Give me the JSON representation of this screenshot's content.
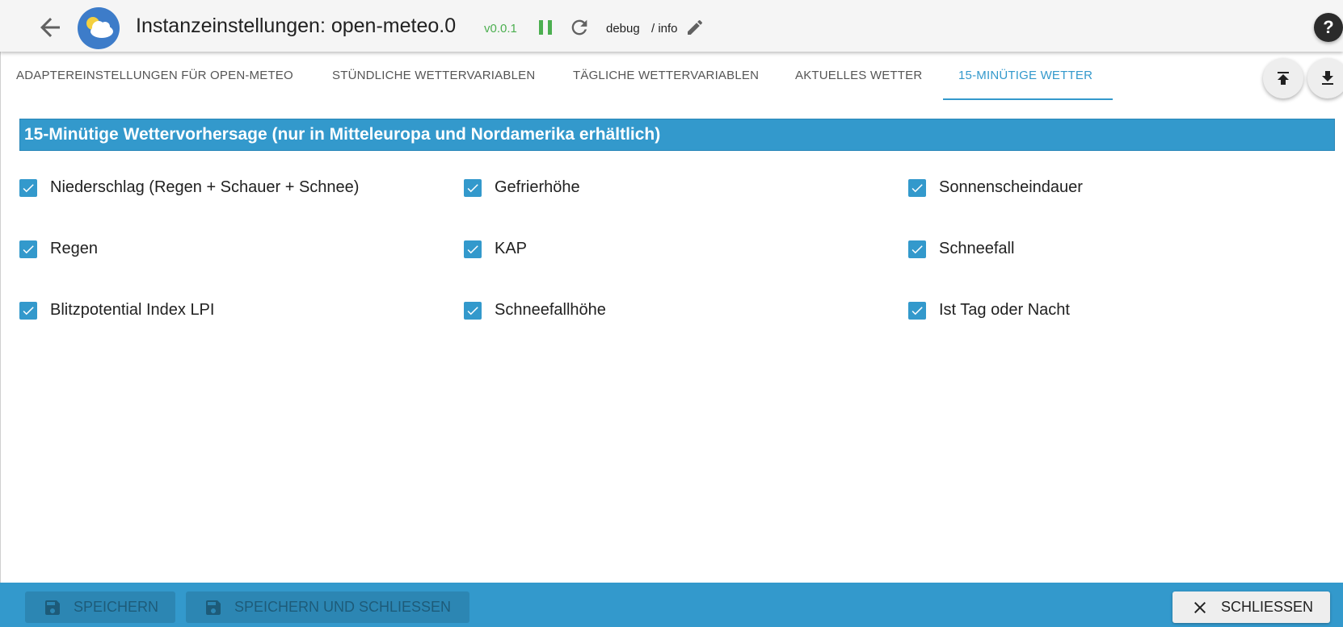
{
  "header": {
    "title": "Instanzeinstellungen: open-meteo.0",
    "version": "v0.0.1",
    "loglevel": "debug",
    "loglevel_sep": "/ info",
    "help_label": "?"
  },
  "tabs": [
    {
      "label": "Adaptereinstellungen für open-meteo",
      "active": false
    },
    {
      "label": "Stündliche Wettervariablen",
      "active": false
    },
    {
      "label": "Tägliche Wettervariablen",
      "active": false
    },
    {
      "label": "Aktuelles Wetter",
      "active": false
    },
    {
      "label": "15-Minütige Wetter",
      "active": true
    }
  ],
  "section": {
    "title": "15-Minütige Wettervorhersage (nur in Mitteleuropa und Nordamerika erhältlich)"
  },
  "options": [
    {
      "label": "Niederschlag (Regen + Schauer + Schnee)",
      "checked": true
    },
    {
      "label": "Gefrierhöhe",
      "checked": true
    },
    {
      "label": "Sonnenscheindauer",
      "checked": true
    },
    {
      "label": "Regen",
      "checked": true
    },
    {
      "label": "KAP",
      "checked": true
    },
    {
      "label": "Schneefall",
      "checked": true
    },
    {
      "label": "Blitzpotential Index LPI",
      "checked": true
    },
    {
      "label": "Schneefallhöhe",
      "checked": true
    },
    {
      "label": "Ist Tag oder Nacht",
      "checked": true
    }
  ],
  "footer": {
    "save_label": "Speichern",
    "save_close_label": "Speichern und schließen",
    "close_label": "Schliessen"
  },
  "colors": {
    "accent": "#3399cc",
    "status_green": "#4caf50"
  }
}
